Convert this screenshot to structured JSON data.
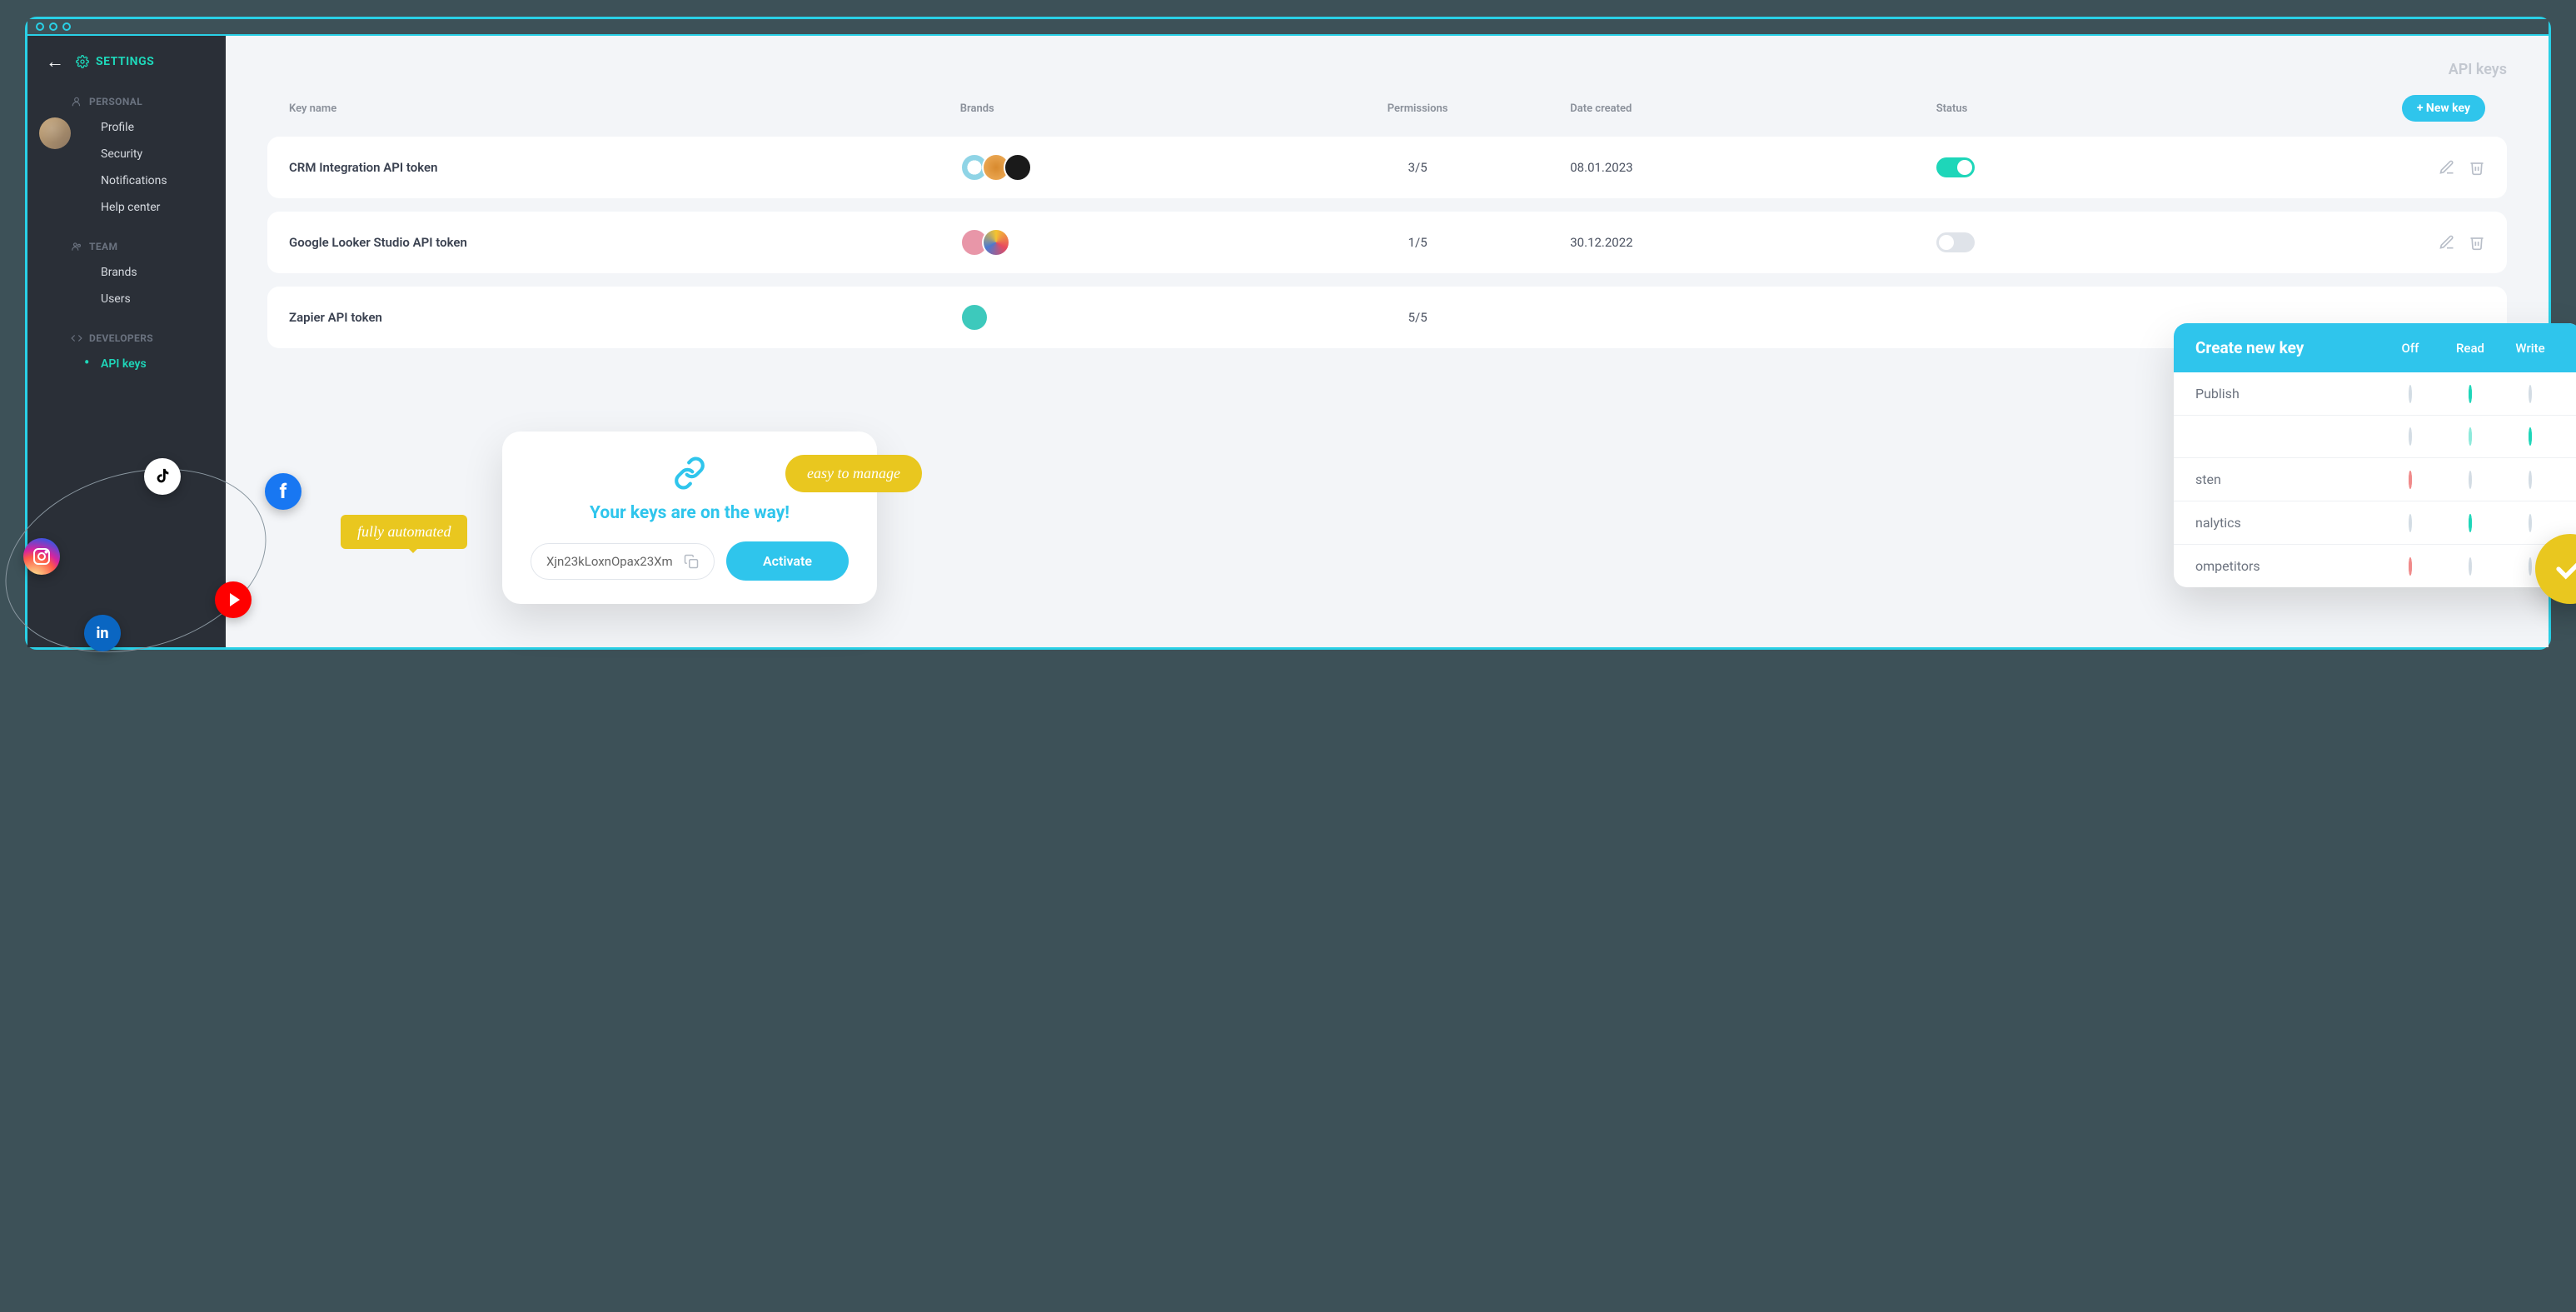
{
  "header": {
    "settings": "SETTINGS"
  },
  "sidebar": {
    "personal_title": "PERSONAL",
    "personal": [
      "Profile",
      "Security",
      "Notifications",
      "Help center"
    ],
    "team_title": "TEAM",
    "team": [
      "Brands",
      "Users"
    ],
    "dev_title": "DEVELOPERS",
    "dev": [
      "API keys"
    ]
  },
  "page": {
    "title": "API keys"
  },
  "table": {
    "headers": {
      "name": "Key name",
      "brands": "Brands",
      "perms": "Permissions",
      "date": "Date created",
      "status": "Status"
    },
    "new_key": "+ New key",
    "rows": [
      {
        "name": "CRM Integration API token",
        "perms": "3/5",
        "date": "08.01.2023",
        "status": "on"
      },
      {
        "name": "Google Looker Studio API token",
        "perms": "1/5",
        "date": "30.12.2022",
        "status": "off"
      },
      {
        "name": "Zapier API token",
        "perms": "5/5",
        "date": "",
        "status": ""
      }
    ]
  },
  "keys_card": {
    "title": "Your keys are on the way!",
    "value": "Xjn23kLoxnOpax23Xm",
    "activate": "Activate"
  },
  "callouts": {
    "automated": "fully automated",
    "manage": "easy to manage"
  },
  "perm": {
    "title": "Create new key",
    "cols": [
      "Off",
      "Read",
      "Write"
    ],
    "rows": [
      {
        "label": "Publish",
        "off": "",
        "read": "green",
        "write": ""
      },
      {
        "label": "",
        "off": "",
        "read": "green-light",
        "write": "green"
      },
      {
        "label": "sten",
        "off": "red",
        "read": "",
        "write": ""
      },
      {
        "label": "nalytics",
        "off": "",
        "read": "green",
        "write": ""
      },
      {
        "label": "ompetitors",
        "off": "red",
        "read": "",
        "write": ""
      }
    ]
  }
}
